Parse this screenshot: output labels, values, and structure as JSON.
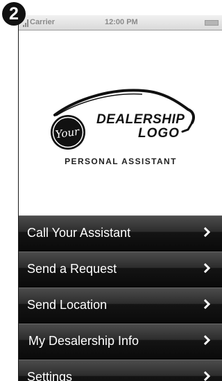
{
  "step_number": "2",
  "status_bar": {
    "carrier": "Carrier",
    "time": "12:00 PM"
  },
  "logo": {
    "emblem_text": "Your",
    "line1": "DEALERSHIP",
    "line2": "LOGO"
  },
  "subtitle": "PERSONAL ASSISTANT",
  "menu": {
    "items": [
      {
        "label": "Call Your Assistant",
        "icon": "chevron-right-icon"
      },
      {
        "label": "Send a Request",
        "icon": "chevron-right-icon"
      },
      {
        "label": "Send Location",
        "icon": "chevron-right-icon"
      },
      {
        "label": "My Desalership Info",
        "icon": "chevron-right-icon"
      },
      {
        "label": "Settings",
        "icon": "chevron-right-icon"
      }
    ]
  },
  "colors": {
    "menu_background": "#1a1a1a",
    "menu_text": "#ffffff",
    "badge_background": "#111111"
  }
}
